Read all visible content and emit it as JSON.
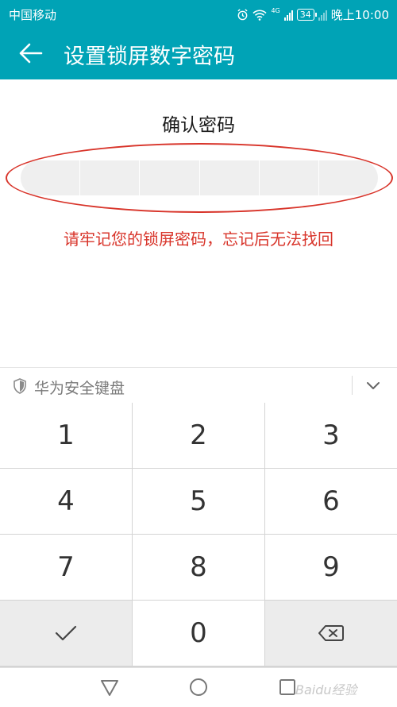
{
  "status_bar": {
    "carrier": "中国移动",
    "network": "4G",
    "battery": "34",
    "time": "晚上10:00"
  },
  "header": {
    "title": "设置锁屏数字密码",
    "background_color": "#00a3b6"
  },
  "content": {
    "prompt": "确认密码",
    "pin_cells": 6,
    "annotation_note": "请牢记您的锁屏密码，忘记后无法找回",
    "annotation_color": "#d8342a"
  },
  "keyboard": {
    "title": "华为安全键盘",
    "keys": [
      "1",
      "2",
      "3",
      "4",
      "5",
      "6",
      "7",
      "8",
      "9",
      "✓",
      "0",
      "⌫"
    ]
  },
  "navigation": {
    "back_icon": "triangle-back-icon",
    "home_icon": "circle-home-icon",
    "recent_icon": "square-recent-icon"
  },
  "watermark": "Baidu经验"
}
